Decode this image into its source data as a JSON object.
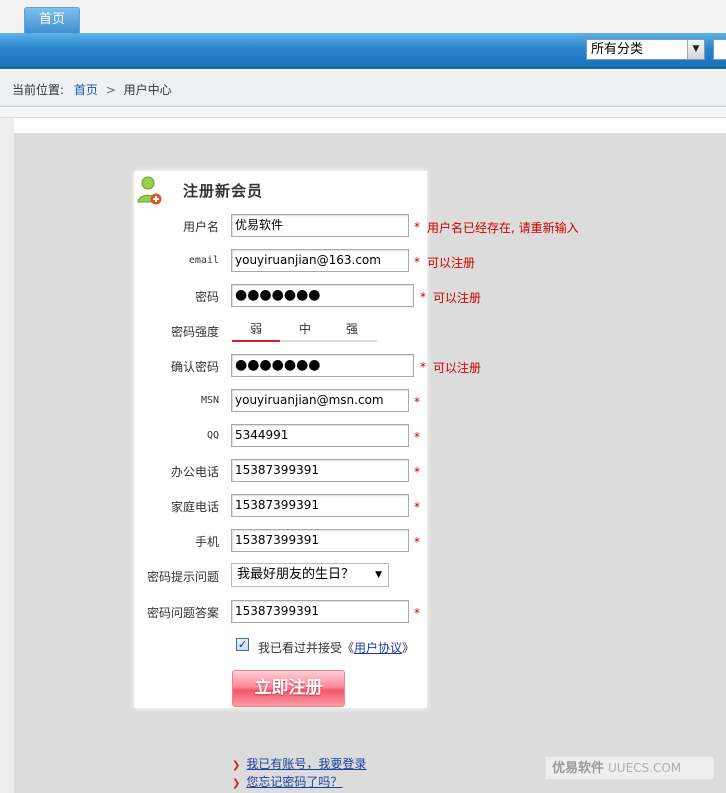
{
  "nav": {
    "home_tab": "首页",
    "category_select": "所有分类"
  },
  "breadcrumb": {
    "prefix": "当前位置:",
    "home": "首页",
    "separator": ">",
    "current": "用户中心"
  },
  "form": {
    "title": "注册新会员",
    "fields": {
      "username": {
        "label": "用户名",
        "value": "优易软件",
        "message": "用户名已经存在, 请重新输入"
      },
      "email": {
        "label": "email",
        "value": "youyiruanjian@163.com",
        "message": "可以注册"
      },
      "password": {
        "label": "密码",
        "value": "●●●●●●●",
        "message": "可以注册"
      },
      "strength": {
        "label": "密码强度",
        "weak": "弱",
        "medium": "中",
        "strong": "强",
        "level": "弱"
      },
      "confirm_password": {
        "label": "确认密码",
        "value": "●●●●●●●",
        "message": "可以注册"
      },
      "msn": {
        "label": "MSN",
        "value": "youyiruanjian@msn.com"
      },
      "qq": {
        "label": "QQ",
        "value": "5344991"
      },
      "office_phone": {
        "label": "办公电话",
        "value": "15387399391"
      },
      "home_phone": {
        "label": "家庭电话",
        "value": "15387399391"
      },
      "mobile": {
        "label": "手机",
        "value": "15387399391"
      },
      "question": {
        "label": "密码提示问题",
        "value": "我最好朋友的生日？"
      },
      "answer": {
        "label": "密码问题答案",
        "value": "15387399391"
      }
    },
    "required_mark": "*",
    "agree": {
      "checked": true,
      "text": "我已看过并接受《",
      "link": "用户协议",
      "suffix": "》"
    },
    "submit_label": "立即注册"
  },
  "links": {
    "login": "我已有账号，我要登录",
    "forgot": "您忘记密码了吗？"
  },
  "watermark": {
    "cn": "优易软件",
    "en": "UUECS.COM"
  },
  "colors": {
    "accent_blue": "#2b85cc",
    "error_red": "#cc0000",
    "link_blue": "#1a3f9e"
  }
}
